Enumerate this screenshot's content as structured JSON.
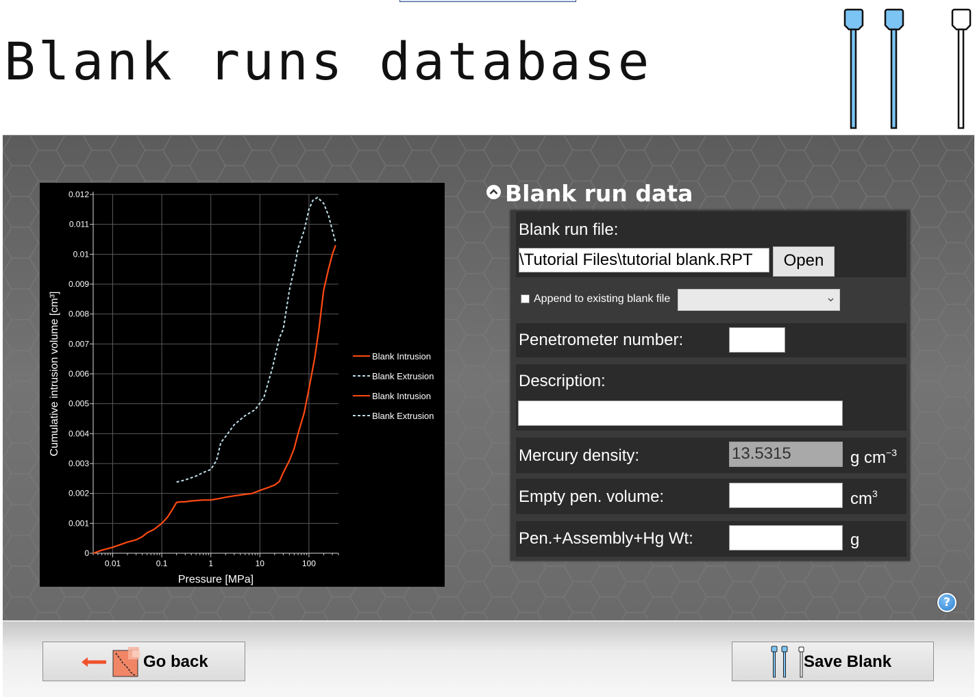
{
  "header": {
    "title": "Blank runs database"
  },
  "section": {
    "title": "Blank run data"
  },
  "form": {
    "blank_file_label": "Blank run file:",
    "blank_file_value": "\\Tutorial Files\\tutorial blank.RPT",
    "open_label": "Open",
    "append_label": "Append to existing blank file",
    "append_checked": false,
    "append_combo_value": "",
    "penetrometer_label": "Penetrometer number:",
    "penetrometer_value": "",
    "description_label": "Description:",
    "description_value": "",
    "mercury_density_label": "Mercury density:",
    "mercury_density_value": "13.5315",
    "mercury_density_unit": "g cm",
    "mercury_density_unit_exp": "−3",
    "empty_pen_label": "Empty pen. volume:",
    "empty_pen_value": "",
    "empty_pen_unit": "cm",
    "empty_pen_unit_exp": "3",
    "pen_weight_label": "Pen.+Assembly+Hg Wt:",
    "pen_weight_value": "",
    "pen_weight_unit": "g"
  },
  "footer": {
    "back_label": "Go back",
    "save_label": "Save Blank"
  },
  "help": {
    "symbol": "?"
  },
  "colors": {
    "intrusion": "#ff4a12",
    "extrusion": "#bfe0ec",
    "accent_icon": "#7cc4f4"
  },
  "chart_data": {
    "type": "line",
    "title": "",
    "xlabel": "Pressure [MPa]",
    "ylabel": "Cumulative intrusion volume [cm³]",
    "x_scale": "log",
    "xlim": [
      0.004,
      400
    ],
    "ylim": [
      0,
      0.012
    ],
    "x_ticks": [
      0.01,
      0.1,
      1,
      10,
      100
    ],
    "x_tick_labels": [
      "0.01",
      "0.1",
      "1",
      "10",
      "100"
    ],
    "y_ticks": [
      0,
      0.001,
      0.002,
      0.003,
      0.004,
      0.005,
      0.006,
      0.007,
      0.008,
      0.009,
      0.01,
      0.011,
      0.012
    ],
    "y_tick_labels": [
      "0",
      "0.001",
      "0.002",
      "0.003",
      "0.004",
      "0.005",
      "0.006",
      "0.007",
      "0.008",
      "0.009",
      "0.01",
      "0.011",
      "0.012"
    ],
    "grid": true,
    "legend_position": "right",
    "legend": [
      "Blank Intrusion",
      "Blank Extrusion",
      "Blank Intrusion",
      "Blank Extrusion"
    ],
    "series": [
      {
        "name": "Blank Intrusion",
        "style": "solid",
        "points": [
          [
            0.004,
            0
          ],
          [
            0.006,
            0.0001
          ],
          [
            0.01,
            0.0002
          ],
          [
            0.015,
            0.0003
          ],
          [
            0.02,
            0.00037
          ],
          [
            0.03,
            0.00045
          ],
          [
            0.04,
            0.00055
          ],
          [
            0.05,
            0.00068
          ],
          [
            0.07,
            0.0008
          ],
          [
            0.1,
            0.001
          ],
          [
            0.13,
            0.0012
          ],
          [
            0.17,
            0.0015
          ],
          [
            0.2,
            0.0017
          ],
          [
            0.25,
            0.00172
          ],
          [
            0.3,
            0.00172
          ],
          [
            0.4,
            0.00175
          ],
          [
            0.5,
            0.00176
          ],
          [
            0.7,
            0.00178
          ],
          [
            1,
            0.00178
          ],
          [
            1.5,
            0.00183
          ],
          [
            2,
            0.00187
          ],
          [
            3,
            0.00192
          ],
          [
            5,
            0.00197
          ],
          [
            7,
            0.002
          ],
          [
            10,
            0.0021
          ],
          [
            15,
            0.0022
          ],
          [
            20,
            0.00228
          ],
          [
            25,
            0.0024
          ],
          [
            30,
            0.0027
          ],
          [
            40,
            0.0031
          ],
          [
            50,
            0.0035
          ],
          [
            60,
            0.004
          ],
          [
            80,
            0.0047
          ],
          [
            100,
            0.0055
          ],
          [
            130,
            0.0065
          ],
          [
            160,
            0.0075
          ],
          [
            200,
            0.0088
          ],
          [
            250,
            0.0095
          ],
          [
            300,
            0.01
          ],
          [
            350,
            0.0103
          ]
        ]
      },
      {
        "name": "Blank Extrusion",
        "style": "dashed",
        "points": [
          [
            0.2,
            0.00238
          ],
          [
            0.3,
            0.00245
          ],
          [
            0.5,
            0.00258
          ],
          [
            0.7,
            0.0027
          ],
          [
            1,
            0.0028
          ],
          [
            1.3,
            0.0031
          ],
          [
            1.6,
            0.0037
          ],
          [
            2,
            0.0039
          ],
          [
            3,
            0.0043
          ],
          [
            5,
            0.0046
          ],
          [
            8,
            0.0048
          ],
          [
            12,
            0.0052
          ],
          [
            18,
            0.0062
          ],
          [
            25,
            0.0072
          ],
          [
            30,
            0.0075
          ],
          [
            40,
            0.0088
          ],
          [
            50,
            0.0095
          ],
          [
            60,
            0.0102
          ],
          [
            80,
            0.0108
          ],
          [
            100,
            0.0115
          ],
          [
            120,
            0.0118
          ],
          [
            150,
            0.0119
          ],
          [
            200,
            0.0117
          ],
          [
            250,
            0.0113
          ],
          [
            300,
            0.0108
          ],
          [
            350,
            0.0104
          ]
        ]
      }
    ]
  }
}
